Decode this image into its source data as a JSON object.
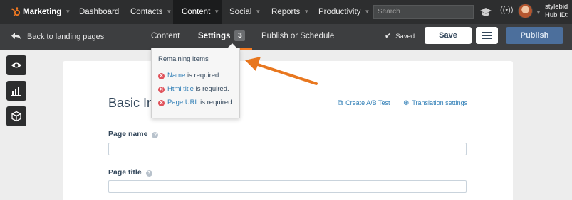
{
  "nav": {
    "brand": "Marketing",
    "items": [
      {
        "label": "Dashboard"
      },
      {
        "label": "Contacts"
      },
      {
        "label": "Content"
      },
      {
        "label": "Social"
      },
      {
        "label": "Reports"
      },
      {
        "label": "Productivity"
      }
    ],
    "search_placeholder": "Search",
    "user_line1": "stylebid",
    "user_line2": "Hub ID:"
  },
  "subbar": {
    "back_label": "Back to landing pages",
    "tabs": [
      {
        "label": "Content"
      },
      {
        "label": "Settings",
        "badge": "3"
      },
      {
        "label": "Publish or Schedule"
      }
    ],
    "saved_label": "Saved",
    "save_button": "Save",
    "publish_button": "Publish"
  },
  "popover": {
    "title": "Remaining items",
    "items": [
      {
        "link": "Name",
        "text": " is required."
      },
      {
        "link": "Html title",
        "text": " is required."
      },
      {
        "link": "Page URL",
        "text": " is required."
      }
    ]
  },
  "main": {
    "section_title": "Basic In",
    "links": {
      "ab_test": "Create A/B Test",
      "translation": "Translation settings"
    },
    "fields": [
      {
        "label": "Page name",
        "value": ""
      },
      {
        "label": "Page title",
        "value": ""
      }
    ]
  },
  "colors": {
    "accent": "#f27a22",
    "nav_bg": "#2d2e2f",
    "link": "#2f7eb6",
    "publish": "#4c6f9c",
    "error": "#e0525b"
  }
}
